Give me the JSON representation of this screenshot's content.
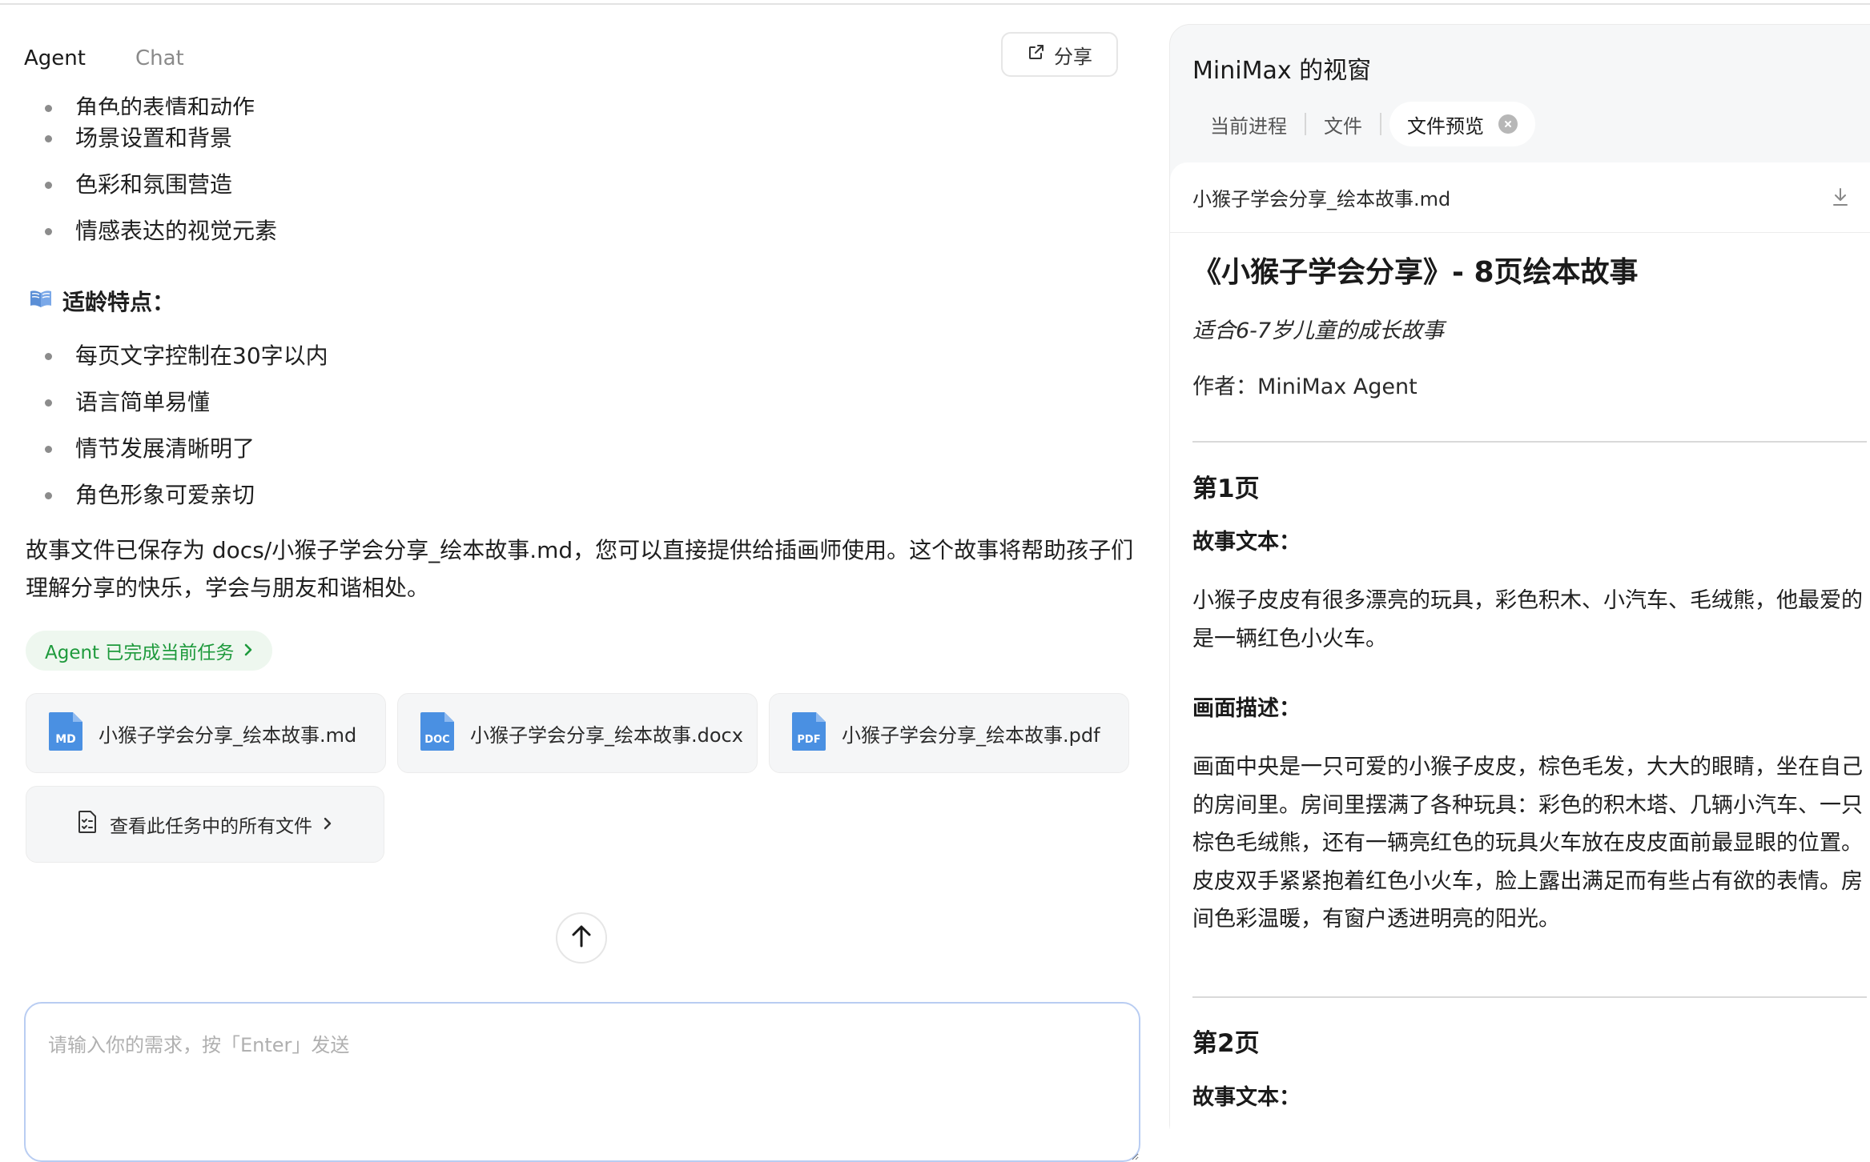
{
  "header": {
    "tabs": [
      "Agent",
      "Chat"
    ],
    "share_label": "分享"
  },
  "chat": {
    "bullets_top": [
      "角色的表情和动作",
      "场景设置和背景",
      "色彩和氛围营造",
      "情感表达的视觉元素"
    ],
    "section_icon": "open-book-icon",
    "section_title": "适龄特点：",
    "bullets_age": [
      "每页文字控制在30字以内",
      "语言简单易懂",
      "情节发展清晰明了",
      "角色形象可爱亲切"
    ],
    "summary_line1": "故事文件已保存为 docs/小猴子学会分享_绘本故事.md，您可以直接提供给插画师使用。这个故事将帮助孩子们",
    "summary_line2": "理解分享的快乐，学会与朋友和谐相处。",
    "done_label": "Agent 已完成当前任务",
    "files": [
      {
        "badge": "MD",
        "name": "小猴子学会分享_绘本故事.md"
      },
      {
        "badge": "DOC",
        "name": "小猴子学会分享_绘本故事.docx"
      },
      {
        "badge": "PDF",
        "name": "小猴子学会分享_绘本故事.pdf"
      }
    ],
    "all_files_label": "查看此任务中的所有文件",
    "input_placeholder": "请输入你的需求，按「Enter」发送"
  },
  "panel": {
    "title": "MiniMax 的视窗",
    "tabs": [
      "当前进程",
      "文件",
      "文件预览"
    ],
    "file_name": "小猴子学会分享_绘本故事.md",
    "doc": {
      "title": "《小猴子学会分享》- 8页绘本故事",
      "subtitle": "适合6-7岁儿童的成长故事",
      "author": "作者：MiniMax Agent",
      "page1_heading": "第1页",
      "story_label": "故事文本：",
      "page1_story": "小猴子皮皮有很多漂亮的玩具，彩色积木、小汽车、毛绒熊，他最爱的是一辆红色小火车。",
      "scene_label": "画面描述：",
      "page1_scene": "画面中央是一只可爱的小猴子皮皮，棕色毛发，大大的眼睛，坐在自己的房间里。房间里摆满了各种玩具：彩色的积木塔、几辆小汽车、一只棕色毛绒熊，还有一辆亮红色的玩具火车放在皮皮面前最显眼的位置。皮皮双手紧紧抱着红色小火车，脸上露出满足而有些占有欲的表情。房间色彩温暖，有窗户透进明亮的阳光。",
      "page2_heading": "第2页",
      "page2_story_label": "故事文本："
    }
  },
  "colors": {
    "accent_blue": "#4a90e2",
    "success_green": "#1e9a3c",
    "success_bg": "#eef7ef"
  }
}
